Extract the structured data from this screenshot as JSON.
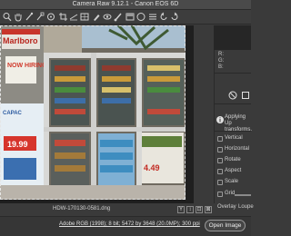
{
  "window": {
    "title": "Camera Raw 9.12.1  -  Canon EOS 6D"
  },
  "toolbar": {
    "tools": [
      {
        "name": "zoom-tool-icon",
        "glyph": "🔍"
      },
      {
        "name": "hand-tool-icon",
        "glyph": "✋"
      },
      {
        "name": "white-balance-icon",
        "glyph": "/"
      },
      {
        "name": "color-sampler-icon",
        "glyph": "⌖"
      },
      {
        "name": "targeted-adjustment-icon",
        "glyph": "◎"
      },
      {
        "name": "crop-tool-icon",
        "glyph": "⌗"
      },
      {
        "name": "straighten-tool-icon",
        "glyph": "⦨"
      },
      {
        "name": "transform-tool-icon",
        "glyph": "▦"
      },
      {
        "name": "spot-removal-icon",
        "glyph": "✎"
      },
      {
        "name": "red-eye-icon",
        "glyph": "◉"
      },
      {
        "name": "adjustment-brush-icon",
        "glyph": "✐"
      },
      {
        "name": "graduated-filter-icon",
        "glyph": "▭"
      },
      {
        "name": "radial-filter-icon",
        "glyph": "○"
      },
      {
        "name": "preferences-icon",
        "glyph": "☰"
      },
      {
        "name": "rotate-ccw-icon",
        "glyph": "↺"
      },
      {
        "name": "rotate-cw-icon",
        "glyph": "↻"
      }
    ]
  },
  "image": {
    "filename": "HDW-170130-0581.dng",
    "signs": [
      "Marlboro",
      "NOW HIRING",
      "CAPAC",
      "19.99",
      "4.49"
    ]
  },
  "workflow": {
    "link": "Adobe RGB (1998); 8 bit; 5472 by 3648 (20.0MP); 300 ppi"
  },
  "actions": {
    "open_image": "Open Image"
  },
  "histogram": {
    "r": "R:",
    "g": "G:",
    "b": "B:"
  },
  "transform_panel": {
    "applying": [
      "Applying Up",
      "transforms."
    ],
    "rows": [
      "Vertical",
      "Horizontal",
      "Rotate",
      "Aspect",
      "Scale",
      "Grid"
    ],
    "overlay": "Overlay",
    "loupe": "Loupe"
  }
}
